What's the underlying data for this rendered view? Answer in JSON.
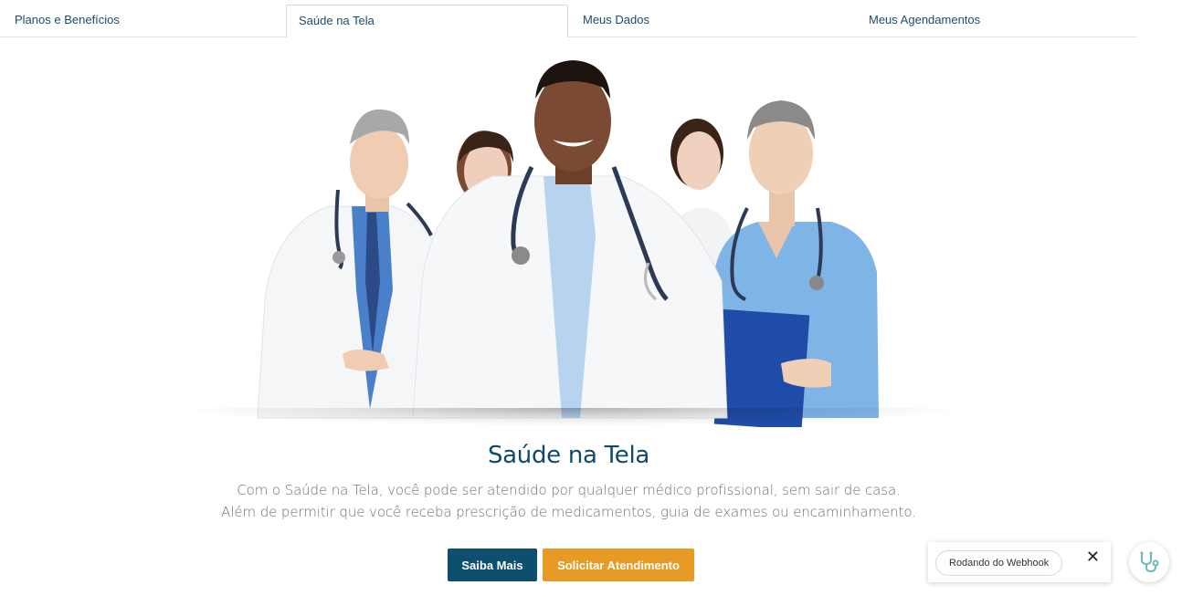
{
  "tabs": [
    {
      "label": "Planos e Benefícios",
      "active": false
    },
    {
      "label": "Saúde na Tela",
      "active": true
    },
    {
      "label": "Meus Dados",
      "active": false
    },
    {
      "label": "Meus Agendamentos",
      "active": false
    }
  ],
  "hero": {
    "image_alt_icon": "doctors-team-image"
  },
  "content": {
    "title": "Saúde na Tela",
    "description_line1": "Com o Saúde na Tela, você pode ser atendido por qualquer médico profissional, sem sair de casa.",
    "description_line2": "Além de permitir que você receba prescrição de medicamentos, guia de exames ou encaminhamento."
  },
  "buttons": {
    "saiba_mais": "Saiba Mais",
    "solicitar": "Solicitar Atendimento"
  },
  "toast": {
    "label": "Rodando do Webhook",
    "close_icon": "close-icon"
  },
  "fab": {
    "icon": "stethoscope-icon"
  },
  "colors": {
    "primary": "#0e4f6e",
    "accent": "#e89a27",
    "tab_text": "#1b4d68"
  }
}
